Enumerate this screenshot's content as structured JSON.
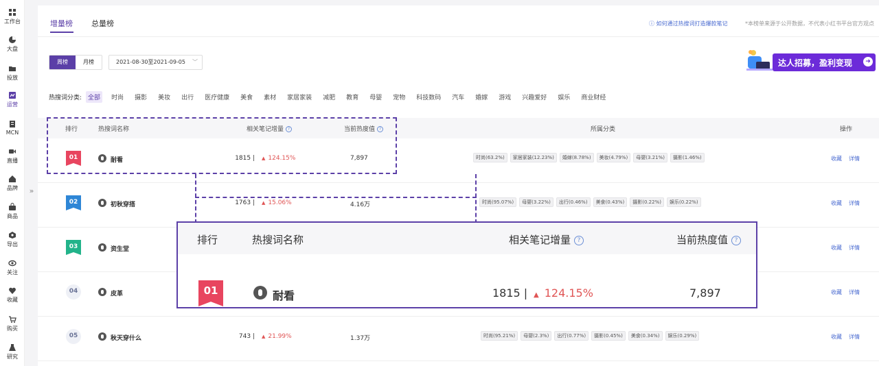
{
  "nav": [
    {
      "label": "工作台",
      "icon": "grid-icon"
    },
    {
      "label": "大盘",
      "icon": "pie-chart-icon"
    },
    {
      "label": "投放",
      "icon": "folder-icon"
    },
    {
      "label": "运营",
      "icon": "trend-chart-icon"
    },
    {
      "label": "MCN",
      "icon": "document-icon"
    },
    {
      "label": "直播",
      "icon": "video-camera-icon"
    },
    {
      "label": "品牌",
      "icon": "home-icon"
    },
    {
      "label": "商品",
      "icon": "shopping-bag-icon"
    },
    {
      "label": "导出",
      "icon": "export-icon"
    },
    {
      "label": "关注",
      "icon": "eye-icon"
    },
    {
      "label": "收藏",
      "icon": "heart-icon"
    },
    {
      "label": "购买",
      "icon": "cart-icon"
    },
    {
      "label": "研究",
      "icon": "flask-icon"
    }
  ],
  "active_nav": "运营",
  "collapse_glyph": "»",
  "tabs": {
    "incr": "增量榜",
    "total": "总量榜"
  },
  "help_link": "ⓘ 如何通过热搜词打造爆款笔记",
  "disclaimer": "*本榜单来源于公开数据，不代表小红书平台官方观点",
  "period": {
    "weekly": "周榜",
    "monthly": "月榜"
  },
  "date_range": "2021-08-30至2021-09-05",
  "banner": {
    "text": "达人招募，盈利变现",
    "arrow": "➜",
    "colors": {
      "bg": "#6c2bd9"
    }
  },
  "category_label": "热搜词分类:",
  "categories": [
    "全部",
    "时尚",
    "摄影",
    "美妆",
    "出行",
    "医疗健康",
    "美食",
    "素材",
    "家居家装",
    "减肥",
    "教育",
    "母婴",
    "宠物",
    "科技数码",
    "汽车",
    "婚嫁",
    "游戏",
    "兴趣爱好",
    "娱乐",
    "商业财经"
  ],
  "headers": {
    "rank": "排行",
    "keyword": "热搜词名称",
    "notes_incr": "相关笔记增量",
    "heat": "当前热度值",
    "category": "所属分类",
    "action": "操作",
    "q": "?"
  },
  "actions": {
    "fav": "收藏",
    "detail": "详情"
  },
  "rows": [
    {
      "rank": "01",
      "keyword": "耐看",
      "count": "1815 |",
      "change": "124.15%",
      "heat": "7,897",
      "tags": [
        "时尚(63.2%)",
        "家居家装(12.23%)",
        "婚嫁(8.78%)",
        "美妆(4.79%)",
        "母婴(3.21%)",
        "摄影(1.46%)"
      ]
    },
    {
      "rank": "02",
      "keyword": "初秋穿搭",
      "count": "1763 |",
      "change": "15.06%",
      "heat": "4.16万",
      "tags": [
        "时尚(95.07%)",
        "母婴(3.22%)",
        "出行(0.46%)",
        "美食(0.43%)",
        "摄影(0.22%)",
        "娱乐(0.22%)"
      ]
    },
    {
      "rank": "03",
      "keyword": "资生堂",
      "count": "",
      "change": "",
      "heat": "",
      "tags": []
    },
    {
      "rank": "04",
      "keyword": "皮革",
      "count": "",
      "change": "",
      "heat": "",
      "tags": []
    },
    {
      "rank": "05",
      "keyword": "秋天穿什么",
      "count": "743 |",
      "change": "21.99%",
      "heat": "1.37万",
      "tags": [
        "时尚(95.21%)",
        "母婴(2.3%)",
        "出行(0.77%)",
        "摄影(0.45%)",
        "美食(0.34%)",
        "娱乐(0.29%)"
      ]
    }
  ],
  "zoom": {
    "rank": "01",
    "keyword": "耐看",
    "count": "1815 |",
    "change": "124.15%",
    "heat": "7,897"
  },
  "up_glyph": "▲",
  "colors": {
    "accent": "#5b3fa7",
    "up": "#e05555",
    "rank1": "#e8455f",
    "rank2": "#2e86d6",
    "rank3": "#22b38a"
  }
}
